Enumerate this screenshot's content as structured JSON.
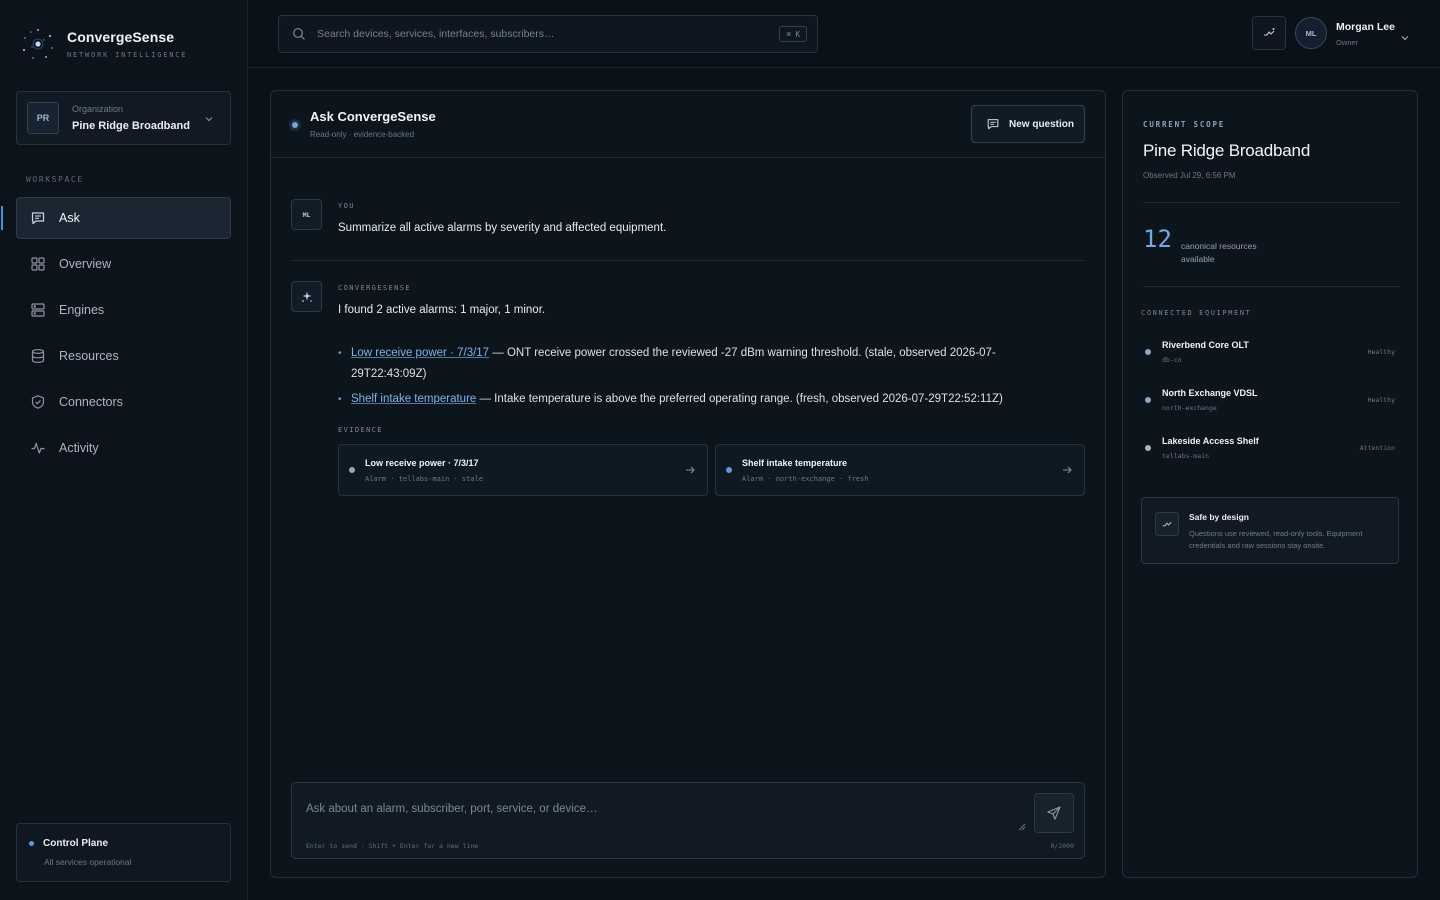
{
  "brand": {
    "name": "ConvergeSense",
    "tagline": "NETWORK INTELLIGENCE"
  },
  "organization": {
    "label": "Organization",
    "initials": "PR",
    "name": "Pine Ridge Broadband"
  },
  "nav": {
    "section_label": "WORKSPACE",
    "items": [
      {
        "label": "Ask",
        "icon": "chat-icon",
        "active": true
      },
      {
        "label": "Overview",
        "icon": "grid-icon"
      },
      {
        "label": "Engines",
        "icon": "server-icon"
      },
      {
        "label": "Resources",
        "icon": "database-icon"
      },
      {
        "label": "Connectors",
        "icon": "shield-icon"
      },
      {
        "label": "Activity",
        "icon": "pulse-icon"
      }
    ]
  },
  "control_plane": {
    "title": "Control Plane",
    "status": "All services operational"
  },
  "search": {
    "placeholder": "Search devices, services, interfaces, subscribers…",
    "shortcut": "⌘ K"
  },
  "user": {
    "initials": "ML",
    "name": "Morgan Lee",
    "role": "Owner"
  },
  "chat": {
    "title": "Ask ConvergeSense",
    "subtitle": "Read-only · evidence-backed",
    "new_question_label": "New question",
    "user_message": {
      "initials": "ML",
      "role": "YOU",
      "text": "Summarize all active alarms by severity and affected equipment."
    },
    "assistant_message": {
      "role": "CONVERGESENSE",
      "summary": "I found 2 active alarms: 1 major, 1 minor.",
      "bullets": [
        {
          "link": "Low receive power · 7/3/17",
          "text": " — ONT receive power crossed the reviewed -27 dBm warning threshold. (stale, observed 2026-07-29T22:43:09Z)"
        },
        {
          "link": "Shelf intake temperature",
          "text": " — Intake temperature is above the preferred operating range. (fresh, observed 2026-07-29T22:52:11Z)"
        }
      ],
      "evidence_label": "EVIDENCE",
      "evidence": [
        {
          "title": "Low receive power · 7/3/17",
          "meta": "Alarm · tellabs-main · stale",
          "dot_color": "#9aa8b6"
        },
        {
          "title": "Shelf intake temperature",
          "meta": "Alarm · north-exchange · fresh",
          "dot_color": "#5d9ade"
        }
      ]
    },
    "composer": {
      "placeholder": "Ask about an alarm, subscriber, port, service, or device…",
      "hint": "Enter to send · Shift + Enter for a new line",
      "count": "0/2000"
    }
  },
  "scope": {
    "label": "CURRENT SCOPE",
    "title": "Pine Ridge Broadband",
    "observed": "Observed Jul 29, 6:56 PM",
    "resource_count": "12",
    "resource_label": "canonical resources available",
    "equipment_label": "CONNECTED EQUIPMENT",
    "equipment": [
      {
        "name": "Riverbend Core OLT",
        "id": "db-co",
        "status": "Healthy"
      },
      {
        "name": "North Exchange VDSL",
        "id": "north-exchange",
        "status": "Healthy"
      },
      {
        "name": "Lakeside Access Shelf",
        "id": "tellabs-main",
        "status": "Attention"
      }
    ],
    "safe": {
      "title": "Safe by design",
      "text": "Questions use reviewed, read-only tools. Equipment credentials and raw sessions stay onsite."
    }
  },
  "colors": {
    "accent": "#5d9ade",
    "background": "#0a1119",
    "panel": "#0c141c"
  }
}
